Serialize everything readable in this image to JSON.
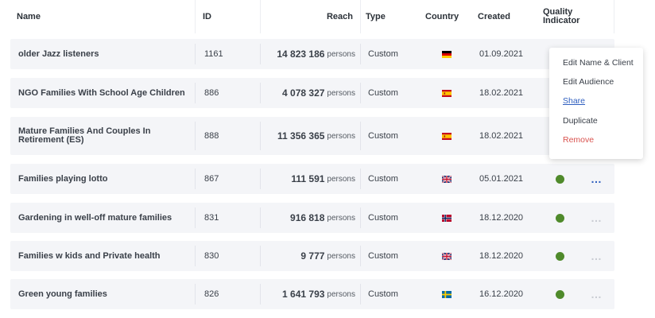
{
  "header": {
    "name": "Name",
    "id": "ID",
    "reach": "Reach",
    "type": "Type",
    "country": "Country",
    "created": "Created",
    "quality_line1": "Quality",
    "quality_line2": "Indicator"
  },
  "rows": [
    {
      "name": "older Jazz listeners",
      "id": "1161",
      "reach": "14 823 186",
      "unit": "persons",
      "type": "Custom",
      "country": "de-flag",
      "created": "01.09.2021"
    },
    {
      "name": "NGO Families With School Age Children",
      "id": "886",
      "reach": "4 078 327",
      "unit": "persons",
      "type": "Custom",
      "country": "es-flag",
      "created": "18.02.2021"
    },
    {
      "name": "Mature Families And Couples In Retirement (ES)",
      "id": "888",
      "reach": "11 356 365",
      "unit": "persons",
      "type": "Custom",
      "country": "es-flag",
      "created": "18.02.2021"
    },
    {
      "name": "Families playing lotto",
      "id": "867",
      "reach": "111 591",
      "unit": "persons",
      "type": "Custom",
      "country": "gb-flag",
      "created": "05.01.2021",
      "quality": "good",
      "more_active": true
    },
    {
      "name": "Gardening in well-off mature families",
      "id": "831",
      "reach": "916 818",
      "unit": "persons",
      "type": "Custom",
      "country": "no-flag",
      "created": "18.12.2020",
      "quality": "good"
    },
    {
      "name": "Families w kids and Private health",
      "id": "830",
      "reach": "9 777",
      "unit": "persons",
      "type": "Custom",
      "country": "gb-flag",
      "created": "18.12.2020",
      "quality": "good"
    },
    {
      "name": "Green young families",
      "id": "826",
      "reach": "1 641 793",
      "unit": "persons",
      "type": "Custom",
      "country": "se-flag",
      "created": "16.12.2020",
      "quality": "good"
    }
  ],
  "more_icon": "…",
  "context_menu": {
    "edit_name": "Edit Name & Client",
    "edit_audience": "Edit Audience",
    "share": "Share",
    "duplicate": "Duplicate",
    "remove": "Remove"
  },
  "colors": {
    "quality_good": "#4f8a2b",
    "link": "#2f5fbf",
    "danger": "#d9534f",
    "row_bg": "#f4f5f8"
  }
}
